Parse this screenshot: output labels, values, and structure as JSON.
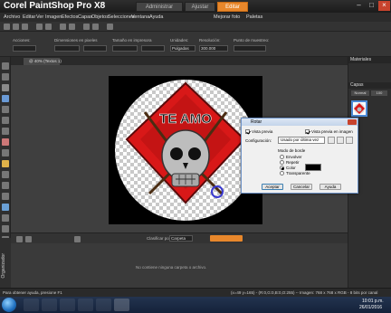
{
  "app": {
    "title": "Corel PaintShop Pro X8",
    "workspace_tabs": [
      "Administrar",
      "Ajustar",
      "Editar"
    ],
    "active_workspace_tab": 2
  },
  "menu": {
    "items": [
      "Archivo",
      "Editar",
      "Ver",
      "Imagen",
      "Efectos",
      "Capas",
      "Objetos",
      "Selecciones",
      "Ventana",
      "Ayuda"
    ],
    "tools": [
      "Mejorar foto",
      "Paletas"
    ]
  },
  "options": {
    "labels": [
      "Acciones:",
      "Dimensiones en pixeles",
      "Tamaño en impresora",
      "Unidades:",
      "Resolución:",
      "Punto de muestreo:"
    ],
    "units_value": "Pulgadas",
    "resolution_value": "300.000"
  },
  "document": {
    "tab_label": "@ 40% (Textos 1)"
  },
  "panels": {
    "materials": "Materiales",
    "layers": "Capas",
    "layer_buttons": [
      "Normal",
      "100"
    ]
  },
  "dialog": {
    "title": "Rotar",
    "preview_label": "Vista previa",
    "preview_on_image_label": "Vista previa en imagen",
    "config_label": "Configuración:",
    "config_value": "Usado por última vez",
    "border_mode_label": "Modo de borde",
    "border_options": [
      "Envolver",
      "Repetir",
      "Color",
      "Transparente"
    ],
    "selected_border_option": 2,
    "color_swatch": "#000000",
    "buttons": [
      "Aceptar",
      "Cancelar",
      "Ayuda"
    ]
  },
  "organizer": {
    "title": "Organizador",
    "toolbar_labels": [
      "Clasificar por:",
      "Carpeta"
    ],
    "empty_message": "No contiene ninguna carpeta o archivo."
  },
  "status": {
    "left": "Para obtener ayuda, presione F1",
    "right": "(x=49 y=165) - (R:0,G:0,B:0,O:255) -- Imagen: 768 x 768 x RGB - 8 bits por canal"
  },
  "taskbar": {
    "time": "10:01 p.m.",
    "date": "26/01/2016"
  },
  "colors": {
    "accent": "#e8872b",
    "dialog_border": "#6a8fc4",
    "logo_red": "#d81818"
  },
  "image_text": "TE AMO"
}
